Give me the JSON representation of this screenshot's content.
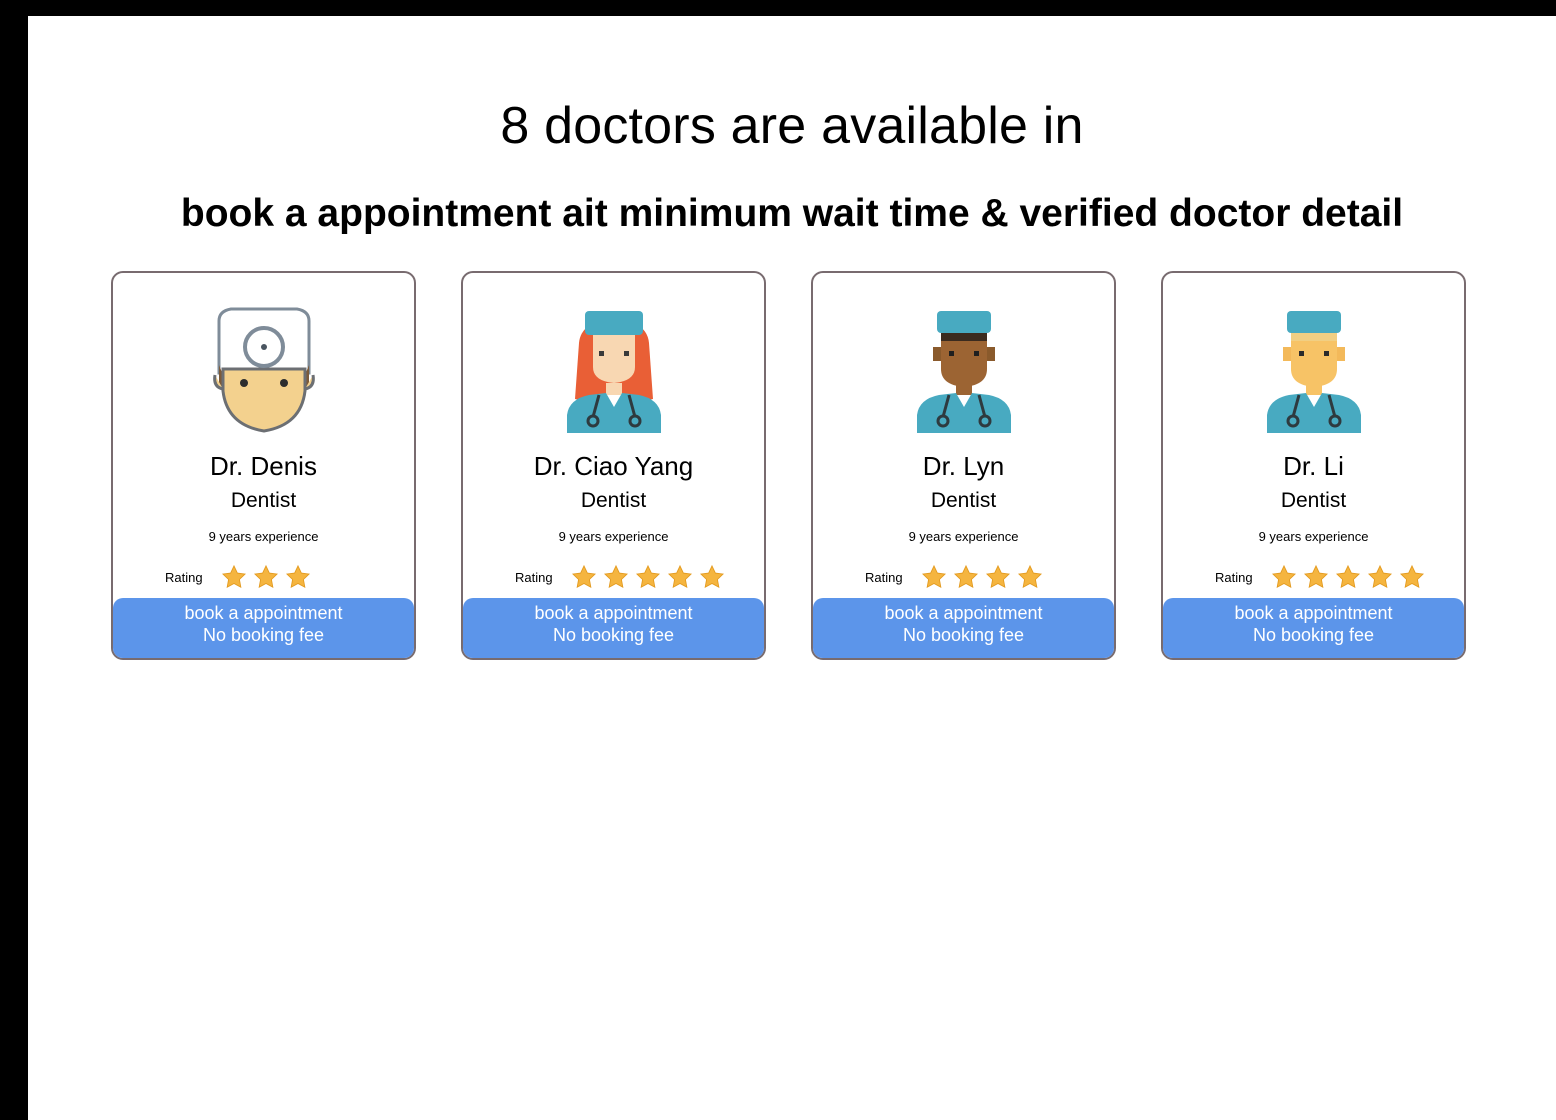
{
  "heading": "8 doctors are available in",
  "subheading": "book a appointment ait minimum wait time & verified doctor detail",
  "colors": {
    "button": "#5c95ea",
    "star": "#f5b53f",
    "card_border": "#786b6f"
  },
  "doctors": [
    {
      "name": "Dr. Denis",
      "specialty": "Dentist",
      "experience": "9 years experience",
      "rating_label": "Rating",
      "rating": 3,
      "button_line1": "book a appointment",
      "button_line2": "No booking fee",
      "avatar_icon": "dentist-head-mirror-icon"
    },
    {
      "name": "Dr. Ciao Yang",
      "specialty": "Dentist",
      "experience": "9 years experience",
      "rating_label": "Rating",
      "rating": 5,
      "button_line1": "book a appointment",
      "button_line2": "No booking fee",
      "avatar_icon": "female-doctor-icon"
    },
    {
      "name": "Dr. Lyn",
      "specialty": "Dentist",
      "experience": "9 years experience",
      "rating_label": "Rating",
      "rating": 4,
      "button_line1": "book a appointment",
      "button_line2": "No booking fee",
      "avatar_icon": "male-doctor-dark-icon"
    },
    {
      "name": "Dr. Li",
      "specialty": "Dentist",
      "experience": "9 years experience",
      "rating_label": "Rating",
      "rating": 5,
      "button_line1": "book a appointment",
      "button_line2": "No booking fee",
      "avatar_icon": "male-doctor-light-icon"
    }
  ]
}
